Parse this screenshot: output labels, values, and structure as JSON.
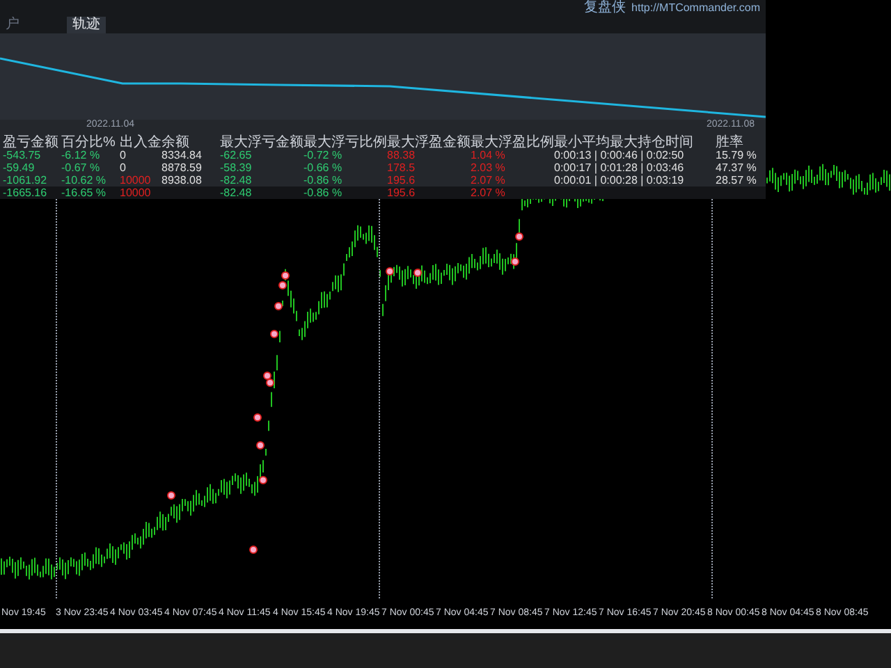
{
  "panel": {
    "brand": "复盘侠",
    "url": "http://MTCommander.com",
    "tabs": [
      {
        "label": "户",
        "selected": false
      },
      {
        "label": "轨迹",
        "selected": true
      }
    ],
    "curve_dates": [
      "2022.11.04",
      "2022.11.08"
    ],
    "table": {
      "columns": [
        {
          "label": "盈亏金额",
          "color": "#2ecc71"
        },
        {
          "label": "百分比%",
          "color": "#2ecc71"
        },
        {
          "label": "出入金",
          "color": "#e0e0e0"
        },
        {
          "label": "余额",
          "color": "#e0e0e0"
        },
        {
          "label": "最大浮亏金额",
          "color": "#2ecc71"
        },
        {
          "label": "最大浮亏比例",
          "color": "#2ecc71"
        },
        {
          "label": "最大浮盈金额",
          "color": "#e02020"
        },
        {
          "label": "最大浮盈比例",
          "color": "#e02020"
        },
        {
          "label": "最小平均最大持仓时间",
          "color": "#e0e0e0"
        },
        {
          "label": "胜率",
          "color": "#e0e0e0"
        }
      ],
      "rows": [
        {
          "summary": false,
          "deposit_alert": false,
          "cells": [
            "-543.75",
            "-6.12 %",
            "0",
            "8334.84",
            "-62.65",
            "-0.72 %",
            "88.38",
            "1.04 %",
            "0:00:13 | 0:00:46 | 0:02:50",
            "15.79 %"
          ]
        },
        {
          "summary": false,
          "deposit_alert": false,
          "cells": [
            "-59.49",
            "-0.67 %",
            "0",
            "8878.59",
            "-58.39",
            "-0.66 %",
            "178.5",
            "2.03 %",
            "0:00:17 | 0:01:28 | 0:03:46",
            "47.37 %"
          ]
        },
        {
          "summary": false,
          "deposit_alert": true,
          "cells": [
            "-1061.92",
            "-10.62 %",
            "10000",
            "8938.08",
            "-82.48",
            "-0.86 %",
            "195.6",
            "2.07 %",
            "0:00:01 | 0:00:28 | 0:03:19",
            "28.57 %"
          ]
        },
        {
          "summary": true,
          "deposit_alert": true,
          "cells": [
            "-1665.16",
            "-16.65 %",
            "10000",
            null,
            "-82.48",
            "-0.86 %",
            "195.6",
            "2.07 %",
            null,
            null
          ]
        }
      ]
    }
  },
  "time_axis": [
    "Nov 19:45",
    "3 Nov 23:45",
    "4 Nov 03:45",
    "4 Nov 07:45",
    "4 Nov 11:45",
    "4 Nov 15:45",
    "4 Nov 19:45",
    "7 Nov 00:45",
    "7 Nov 04:45",
    "7 Nov 08:45",
    "7 Nov 12:45",
    "7 Nov 16:45",
    "7 Nov 20:45",
    "8 Nov 00:45",
    "8 Nov 04:45",
    "8 Nov 08:45"
  ]
}
